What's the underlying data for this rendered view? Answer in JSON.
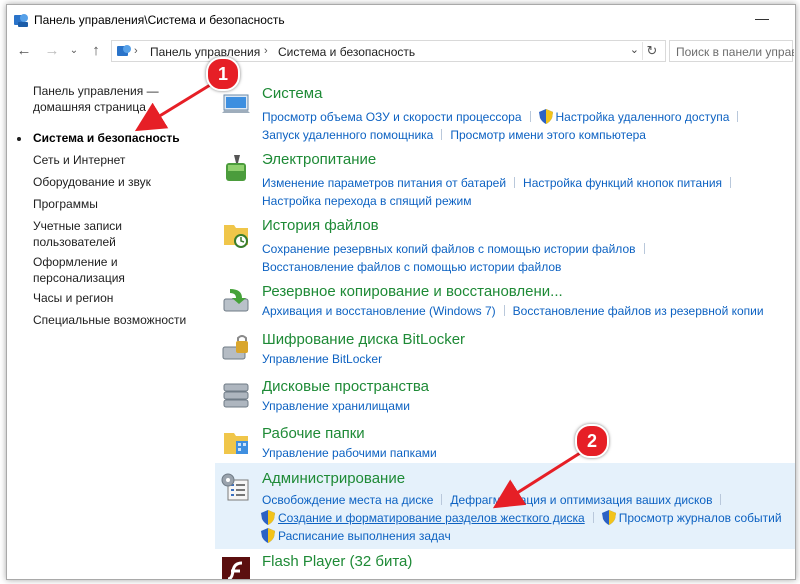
{
  "window": {
    "title": "Панель управления\\Система и безопасность"
  },
  "address": {
    "crumbs": [
      "Панель управления",
      "Система и безопасность"
    ],
    "search_placeholder": "Поиск в панели управ"
  },
  "leftnav": {
    "items": [
      {
        "label": "Панель управления — домашняя страница"
      },
      {
        "label": "Система и безопасность"
      },
      {
        "label": "Сеть и Интернет"
      },
      {
        "label": "Оборудование и звук"
      },
      {
        "label": "Программы"
      },
      {
        "label": "Учетные записи пользователей"
      },
      {
        "label": "Оформление и персонализация"
      },
      {
        "label": "Часы и регион"
      },
      {
        "label": "Специальные возможности"
      }
    ]
  },
  "categories": [
    {
      "title": "Система",
      "icon": "system-icon",
      "links": [
        "Просмотр объема ОЗУ и скорости процессора",
        "Настройка удаленного доступа",
        "Запуск удаленного помощника",
        "Просмотр имени этого компьютера"
      ]
    },
    {
      "title": "Электропитание",
      "icon": "power-icon",
      "links": [
        "Изменение параметров питания от батарей",
        "Настройка функций кнопок питания",
        "Настройка перехода в спящий режим"
      ]
    },
    {
      "title": "История файлов",
      "icon": "file-history-icon",
      "links": [
        "Сохранение резервных копий файлов с помощью истории файлов",
        "Восстановление файлов с помощью истории файлов"
      ]
    },
    {
      "title": "Резервное копирование и восстановлени...",
      "icon": "backup-icon",
      "links": [
        "Архивация и восстановление (Windows 7)",
        "Восстановление файлов из резервной копии"
      ]
    },
    {
      "title": "Шифрование диска BitLocker",
      "icon": "bitlocker-icon",
      "links": [
        "Управление BitLocker"
      ]
    },
    {
      "title": "Дисковые пространства",
      "icon": "storage-spaces-icon",
      "links": [
        "Управление хранилищами"
      ]
    },
    {
      "title": "Рабочие папки",
      "icon": "work-folders-icon",
      "links": [
        "Управление рабочими папками"
      ]
    },
    {
      "title": "Администрирование",
      "icon": "admin-tools-icon",
      "links": [
        "Освобождение места на диске",
        "Дефрагментация и оптимизация ваших дисков",
        "Создание и форматирование разделов жесткого диска",
        "Просмотр журналов событий",
        "Расписание выполнения задач"
      ]
    },
    {
      "title": "Flash Player (32 бита)",
      "icon": "flash-icon",
      "links": []
    }
  ],
  "callouts": [
    "1",
    "2"
  ],
  "colors": {
    "accent_green": "#1e8a36",
    "link_blue": "#0d62c2",
    "highlight": "#e5f1fb",
    "callout_red": "#e61f26"
  }
}
